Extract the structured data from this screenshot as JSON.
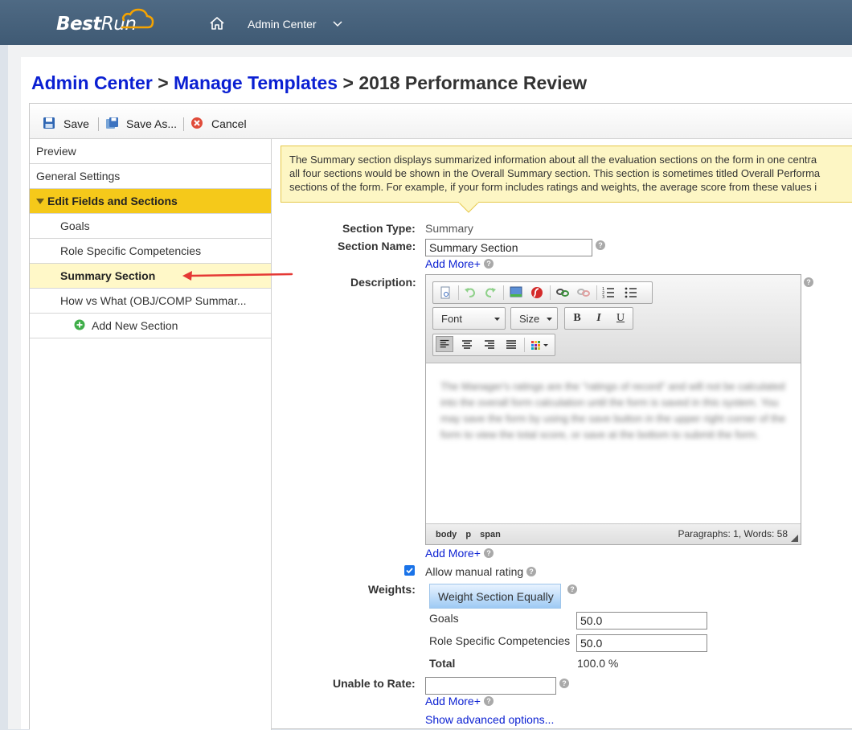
{
  "shell": {
    "logo_bold": "Best",
    "logo_regular": "Run",
    "menu_label": "Admin Center"
  },
  "breadcrumb": {
    "crumb1": "Admin Center",
    "sep1": ">",
    "crumb2": "Manage Templates",
    "sep2": ">",
    "current": "2018 Performance Review"
  },
  "toolbar": {
    "save": "Save",
    "save_as": "Save As...",
    "cancel": "Cancel"
  },
  "nav": {
    "preview": "Preview",
    "general": "General Settings",
    "edit_fields": "Edit Fields and Sections",
    "sections": [
      "Goals",
      "Role Specific Competencies",
      "Summary Section",
      "How vs What (OBJ/COMP Summar..."
    ],
    "add_new": "Add New Section"
  },
  "info": {
    "line1": "The Summary section displays summarized information about all the evaluation sections on the form in one centra",
    "line2": "all four sections would be shown in the Overall Summary section. This section is sometimes titled Overall Performa",
    "line3": "sections of the form. For example, if your form includes ratings and weights, the average score from these values i"
  },
  "form": {
    "section_type_label": "Section Type:",
    "section_type_value": "Summary",
    "section_name_label": "Section Name:",
    "section_name_value": "Summary Section",
    "add_more": "Add More+",
    "description_label": "Description:",
    "editor": {
      "font": "Font",
      "size": "Size",
      "bold": "B",
      "italic": "I",
      "underline": "U",
      "body_text": "The Manager's ratings are the \"ratings of record\" and will not be calculated into the overall form calculation until the form is saved in this system. You may save the form by using the save button in the upper right corner of the form to view the total score, or save at the bottom to submit the form.",
      "path": [
        "body",
        "p",
        "span"
      ],
      "count": "Paragraphs: 1, Words: 58"
    },
    "allow_manual": "Allow manual rating",
    "weights_label": "Weights:",
    "weight_equal_btn": "Weight Section Equally",
    "weights": [
      {
        "name": "Goals",
        "value": "50.0"
      },
      {
        "name": "Role Specific Competencies",
        "value": "50.0"
      }
    ],
    "total_label": "Total",
    "total_value": "100.0 %",
    "unable_label": "Unable to Rate:",
    "unable_value": "",
    "advanced": "Show advanced options..."
  },
  "colors": {
    "shellbar": "#46617b",
    "group_highlight": "#f5c91a",
    "selected_row": "#fff8c8",
    "link": "#0a1fd2",
    "arrow": "#e53935"
  }
}
